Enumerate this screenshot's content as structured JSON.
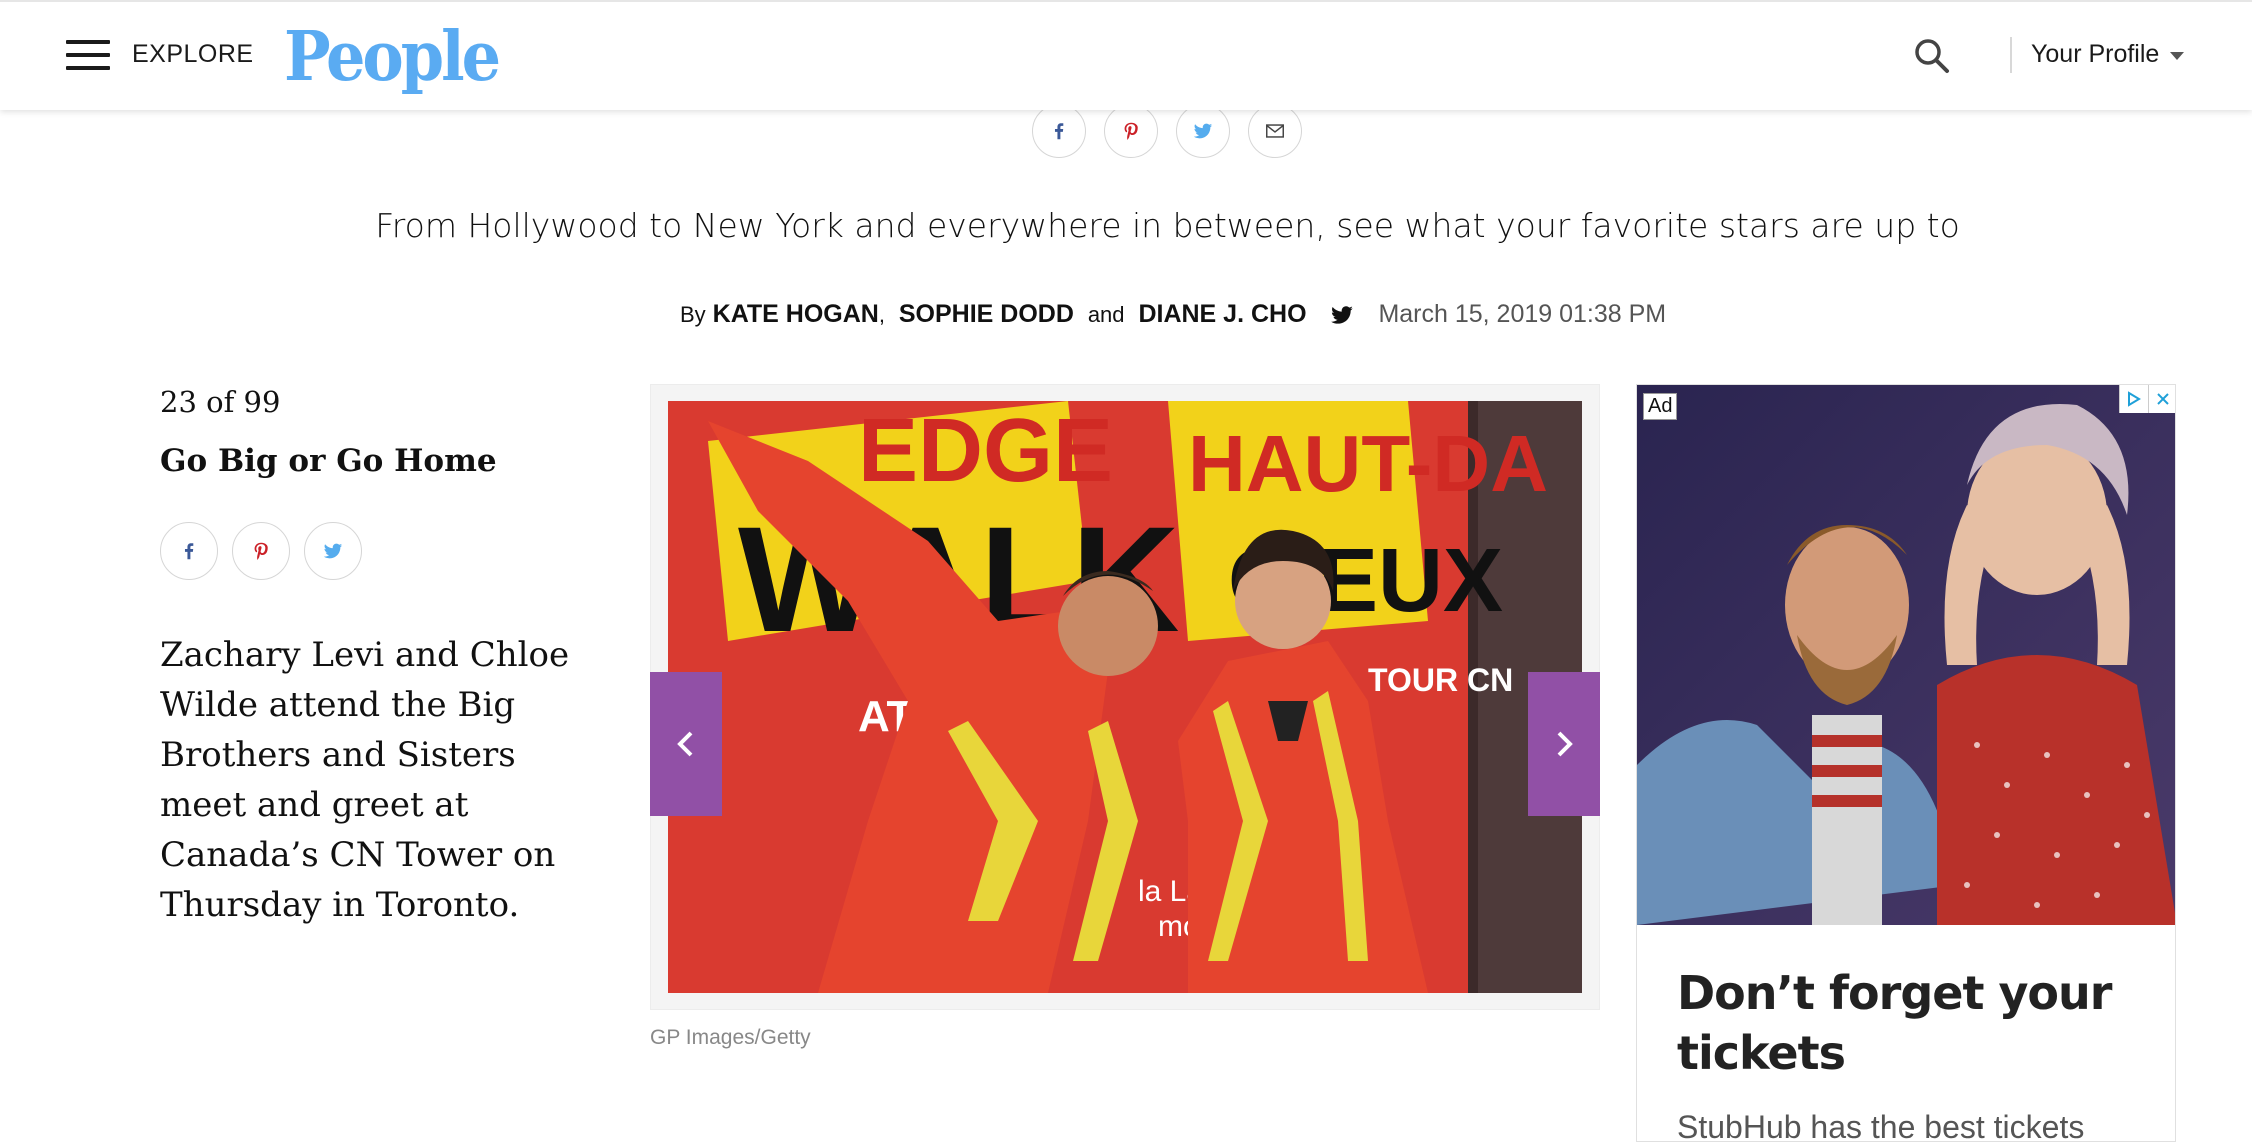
{
  "header": {
    "explore_label": "EXPLORE",
    "logo_text": "People",
    "profile_label": "Your Profile",
    "brand_color": "#5aabf2"
  },
  "share_top": [
    "facebook-icon",
    "pinterest-icon",
    "twitter-icon",
    "email-icon"
  ],
  "article": {
    "dek": "From Hollywood to New York and everywhere in between, see what your favorite stars are up to",
    "byline": {
      "by": "By",
      "author1": "KATE HOGAN",
      "comma": ",",
      "author2": "SOPHIE DODD",
      "and": "and",
      "author3": "DIANE J. CHO",
      "date": "March 15, 2019 01:38 PM"
    }
  },
  "gallery": {
    "counter": "23 of 99",
    "title": "Go Big or Go Home",
    "caption": "Zachary Levi and Chloe Wilde attend the Big Brothers and Sisters meet and greet at Canada’s CN Tower on Thursday in Toronto.",
    "photo_credit": "GP Images/Getty",
    "photo_sign_text": [
      "EDGE",
      "WALK",
      "AT THE C",
      "HAUT-DA",
      "CIEUX",
      "TOUR CN",
      "la Lands Con",
      "mobiliè"
    ],
    "nav_color": "#9150a6"
  },
  "ad": {
    "label": "Ad",
    "headline": "Don’t forget your tickets",
    "subtext": "StubHub has the best tickets"
  }
}
